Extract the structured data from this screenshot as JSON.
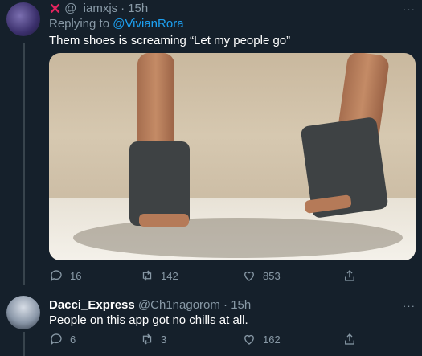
{
  "tweet1": {
    "handle": "@_iamxjs",
    "sep": "·",
    "time": "15h",
    "replying_prefix": "Replying to",
    "replying_to": "@VivianRora",
    "text": "Them shoes is screaming “Let my people go”",
    "replies": "16",
    "retweets": "142",
    "likes": "853",
    "more": "···"
  },
  "tweet2": {
    "name": "Dacci_Express",
    "handle": "@Ch1nagorom",
    "sep": "·",
    "time": "15h",
    "text": "People on this app got no chills at all.",
    "replies": "6",
    "retweets": "3",
    "likes": "162",
    "more": "···"
  },
  "colors": {
    "background": "#15202b",
    "muted": "#8899a6",
    "link": "#1da1f2",
    "x_mark": "#e0245e"
  },
  "icons": [
    "x-icon",
    "reply-icon",
    "retweet-icon",
    "like-icon",
    "share-icon",
    "more-icon"
  ]
}
